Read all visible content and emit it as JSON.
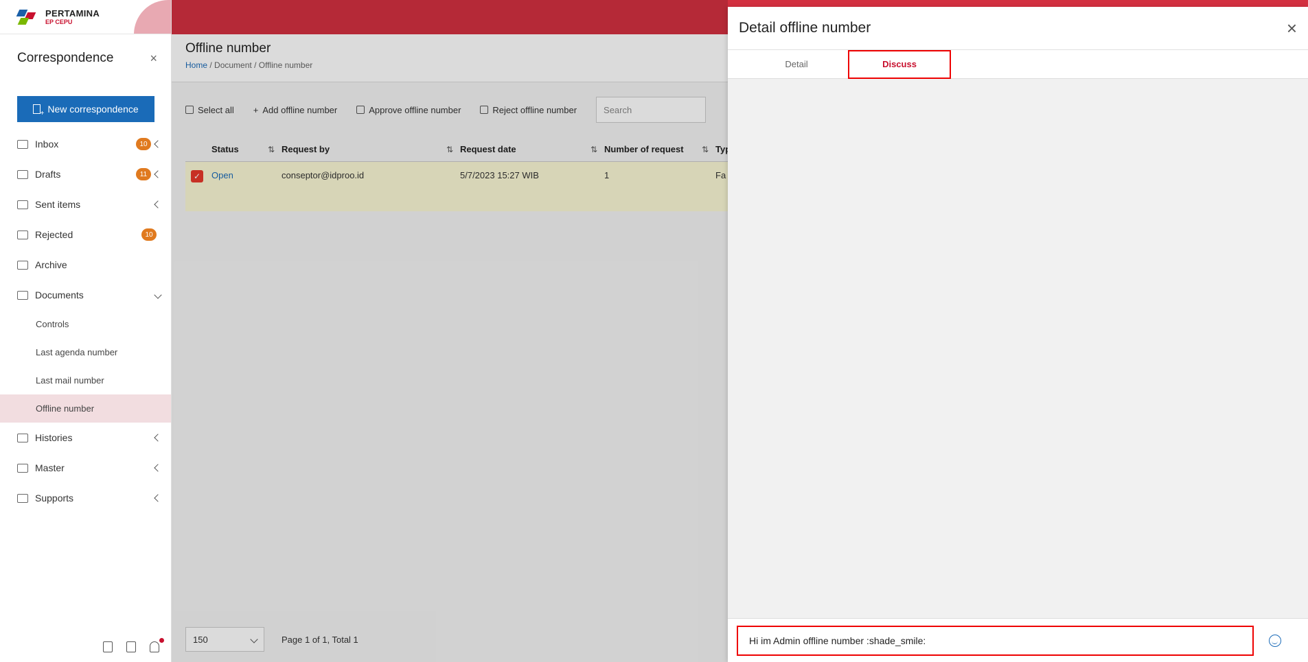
{
  "logo": {
    "name": "PERTAMINA",
    "sub": "EP CEPU"
  },
  "sidebar": {
    "title": "Correspondence",
    "close_symbol": "×",
    "new_button": "New correspondence",
    "items": [
      {
        "label": "Inbox",
        "badge": "10",
        "icon": "inbox-icon"
      },
      {
        "label": "Drafts",
        "badge": "11",
        "icon": "drafts-icon"
      },
      {
        "label": "Sent items",
        "icon": "sent-icon"
      },
      {
        "label": "Rejected",
        "badge": "10",
        "icon": "rejected-icon"
      },
      {
        "label": "Archive",
        "icon": "archive-icon"
      },
      {
        "label": "Documents",
        "icon": "documents-icon"
      }
    ],
    "sub_items": [
      "Controls",
      "Last agenda number",
      "Last mail number",
      "Offline number"
    ],
    "bottom_items": [
      {
        "label": "Histories",
        "icon": "histories-icon"
      },
      {
        "label": "Master",
        "icon": "master-icon"
      },
      {
        "label": "Supports",
        "icon": "supports-icon"
      }
    ]
  },
  "page": {
    "title": "Offline number",
    "breadcrumb": {
      "home": "Home",
      "sep": "/",
      "doc": "Document",
      "current": "Offline number"
    }
  },
  "toolbar": {
    "select_all": "Select all",
    "add": "Add offline number",
    "approve": "Approve offline number",
    "reject": "Reject offline number",
    "search_placeholder": "Search"
  },
  "table": {
    "headers": {
      "status": "Status",
      "request_by": "Request by",
      "request_date": "Request date",
      "number": "Number of request",
      "type": "Typ"
    },
    "sort_symbol": "⇅",
    "row": {
      "check": "✓",
      "status": "Open",
      "request_by": "conseptor@idproo.id",
      "request_date": "5/7/2023 15:27 WIB",
      "number": "1",
      "type": "Fa"
    }
  },
  "pager": {
    "size": "150",
    "info": "Page 1 of 1, Total 1"
  },
  "panel": {
    "title": "Detail offline number",
    "close_symbol": "×",
    "tabs": {
      "detail": "Detail",
      "discuss": "Discuss"
    },
    "message": "Hi im Admin offline number :shade_smile:"
  },
  "colors": {
    "brand_red": "#d33040",
    "accent_blue": "#1a6bb8",
    "badge_orange": "#e07a1f",
    "highlight_outline": "#e00000"
  }
}
